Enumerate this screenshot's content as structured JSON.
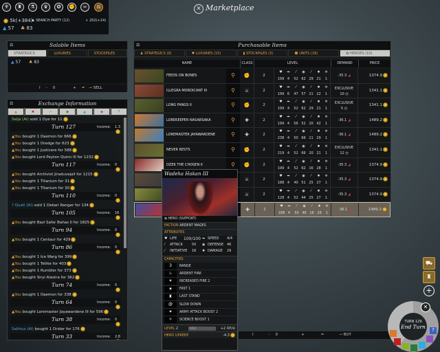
{
  "topbar": {
    "empire_icons": [
      "wreath-emblem-icon",
      "tower-emblem-icon",
      "flask-emblem-icon",
      "trophy-emblem-icon",
      "medal-emblem-icon",
      "fist-emblem-icon",
      "handshake-emblem-icon",
      "marketplace-emblem-icon"
    ],
    "dust": "5k(+384)",
    "search_party": "SEARCH PARTY (12)",
    "stars": "202(+14)",
    "influence": "57",
    "food": "83"
  },
  "title": "Marketplace",
  "salable": {
    "title": "Salable Items",
    "tabs": [
      "STRATEGICS",
      "LUXURIES",
      "STOCKPILES"
    ],
    "active_tab": 0,
    "resources": [
      {
        "icon": "influence-icon",
        "value": "57"
      },
      {
        "icon": "food-icon",
        "value": "83"
      }
    ],
    "quantity": "0",
    "sell_label": "SELL"
  },
  "exchange": {
    "title": "Exchange Information",
    "filters": [
      "orange-empire",
      "red-empire",
      "green-empire",
      "olive-empire",
      "cyan-empire",
      "purple-empire",
      "unknown-empire"
    ],
    "filter_glyphs": [
      "▲",
      "✖",
      "↗",
      "◉",
      "▲",
      "◆",
      "?"
    ],
    "entries": [
      {
        "lines": [
          {
            "who": "Selja (AI)",
            "whoClass": "green",
            "text": " sold 1 Dye for 11"
          }
        ],
        "turn": "Turn 127",
        "income": "1.3"
      },
      {
        "lines": [
          {
            "who": "You",
            "whoClass": "you",
            "text": " bought 1 Daemon for 666"
          },
          {
            "who": "You",
            "whoClass": "you",
            "text": " bought 1 Dredge for 623"
          },
          {
            "who": "You",
            "whoClass": "you",
            "text": " bought 1 Justicere for 588"
          },
          {
            "who": "You",
            "whoClass": "you",
            "text": " bought Lord Peyton Quinn III for 1232"
          }
        ],
        "turn": "Turn 117",
        "income": "0"
      },
      {
        "lines": [
          {
            "who": "You",
            "whoClass": "you",
            "text": " bought Archivist Jiraduvejall for 1215"
          },
          {
            "who": "You",
            "whoClass": "you",
            "text": " bought 1 Titanium for 31"
          },
          {
            "who": "You",
            "whoClass": "you",
            "text": " bought 1 Titanium for 30"
          }
        ],
        "turn": "Turn 110",
        "income": "0"
      },
      {
        "lines": [
          {
            "who": "? Quatl (AI)",
            "whoClass": "blue",
            "text": " sold 1 Dekari Ranger for 134"
          }
        ],
        "turn": "Turn 105",
        "income": "16"
      },
      {
        "lines": [
          {
            "who": "You",
            "whoClass": "you",
            "text": " bought Bazi Safar Bahas II for 1825"
          }
        ],
        "turn": "Turn 94",
        "income": "0"
      },
      {
        "lines": [
          {
            "who": "You",
            "whoClass": "you",
            "text": " bought 1 Centaur for 429"
          }
        ],
        "turn": "Turn 86",
        "income": "0"
      },
      {
        "lines": [
          {
            "who": "You",
            "whoClass": "you",
            "text": " bought 1 Ice Warg for 399"
          },
          {
            "who": "You",
            "whoClass": "you",
            "text": " bought 1 Tetike for 403"
          },
          {
            "who": "You",
            "whoClass": "you",
            "text": " bought 1 Rumbler for 373"
          },
          {
            "who": "You",
            "whoClass": "you",
            "text": " bought Siryi Alastra for 362"
          }
        ],
        "turn": "Turn 74",
        "income": "0"
      },
      {
        "lines": [
          {
            "who": "You",
            "whoClass": "you",
            "text": " bought 1 Daemon for 338"
          }
        ],
        "turn": "Turn 64",
        "income": "0"
      },
      {
        "lines": [
          {
            "who": "You",
            "whoClass": "you",
            "text": " bought Loremaster Jayawardene III for 596"
          }
        ],
        "turn": "Turn 38",
        "income": "0"
      },
      {
        "lines": [
          {
            "who": "Salthus (AI)",
            "whoClass": "blue",
            "text": " bought 1 Drider for 176"
          }
        ],
        "turn": "Turn 33",
        "income": "2.8"
      }
    ],
    "income_label": "Income:"
  },
  "purchasable": {
    "title": "Purchasable Items",
    "tabs": [
      "STRATEGICS (0)",
      "LUXURIES (15)",
      "STOCKPILES (3)",
      "UNITS (18)",
      "HEROES (10)"
    ],
    "active_tab": 4,
    "columns": [
      "NAME",
      "CLASS",
      "LEVEL",
      "DEMAND",
      "PRICE"
    ],
    "stat_icons": [
      "heart-icon",
      "arrow-icon",
      "sword-icon",
      "shield-icon",
      "initiative-icon",
      "damage-icon",
      "gear-icon"
    ],
    "rows": [
      {
        "name": "FEEDS ON BONES",
        "class": "fist",
        "level": "2",
        "stats": [
          "199",
          "4",
          "52",
          "62",
          "29",
          "21",
          "1"
        ],
        "demand": "-35.3",
        "exclusive": false,
        "price": "1374.9",
        "selected": false
      },
      {
        "name": "ILLEGRA MORDICANT III",
        "class": "crossed-swords",
        "level": "2",
        "stats": [
          "199",
          "6",
          "47",
          "57",
          "21",
          "22",
          "1"
        ],
        "demand": "EXCLUSIVE",
        "exclusive_turns": "10",
        "exclusive": true,
        "price": "1341.1",
        "selected": false
      },
      {
        "name": "LONG FANGS II",
        "class": "fist",
        "level": "2",
        "stats": [
          "199",
          "4",
          "52",
          "62",
          "29",
          "21",
          "1"
        ],
        "demand": "EXCLUSIVE",
        "exclusive_turns": "5",
        "exclusive": true,
        "price": "1341.1",
        "selected": false
      },
      {
        "name": "LOREKEEPER NASARSAKA",
        "class": "support",
        "level": "2",
        "stats": [
          "199",
          "4",
          "56",
          "52",
          "20",
          "42",
          "1"
        ],
        "demand": "-36.1",
        "exclusive": false,
        "price": "1489.2",
        "selected": false
      },
      {
        "name": "LOREMASTER JAYAWARDENE",
        "class": "support",
        "level": "2",
        "stats": [
          "238",
          "4",
          "50",
          "66",
          "11",
          "29",
          "1"
        ],
        "demand": "-36.1",
        "exclusive": false,
        "price": "1489.2",
        "selected": false
      },
      {
        "name": "NEVER RESTS",
        "class": "fist",
        "level": "2",
        "stats": [
          "219",
          "4",
          "52",
          "66",
          "20",
          "21",
          "1"
        ],
        "demand": "EXCLUSIVE",
        "exclusive_turns": "12",
        "exclusive": true,
        "price": "1341.1",
        "selected": false
      },
      {
        "name": "OZEK THE CHOSEN II",
        "class": "fist",
        "level": "2",
        "stats": [
          "199",
          "4",
          "52",
          "62",
          "16",
          "28",
          "1"
        ],
        "demand": "-35.3",
        "exclusive": false,
        "price": "1374.9",
        "selected": false
      },
      {
        "name": "",
        "class": "crossed-swords",
        "level": "2",
        "stats": [
          "188",
          "4",
          "40",
          "51",
          "25",
          "27",
          "1"
        ],
        "demand": "-35.3",
        "exclusive": false,
        "price": "1374.9",
        "selected": false
      },
      {
        "name": "",
        "class": "crossed-swords",
        "level": "2",
        "stats": [
          "128",
          "4",
          "52",
          "44",
          "25",
          "27",
          "1"
        ],
        "demand": "-35.3",
        "exclusive": false,
        "price": "1374.9",
        "selected": false
      },
      {
        "name": "",
        "class": "support",
        "level": "2",
        "stats": [
          "188",
          "4",
          "50",
          "46",
          "16",
          "29",
          "1"
        ],
        "demand": "-36.1",
        "exclusive": false,
        "price": "1489.2",
        "selected": true
      }
    ],
    "quantity": "0",
    "buy_label": "BUY"
  },
  "tooltip": {
    "name": "Wadeha Hakan III",
    "type": "HERO (SUPPORT)",
    "faction_label": "FACTION",
    "faction": "ARDENT MAGES",
    "attributes_label": "ATTRIBUTES",
    "attributes": {
      "life_label": "LIFE",
      "life": "100/100",
      "speed_label": "SPEED",
      "speed": "4/4",
      "attack_label": "ATTACK",
      "attack": "50",
      "defense_label": "DEFENSE",
      "defense": "46",
      "initiative_label": "INITIATIVE",
      "initiative": "16",
      "damage_label": "DAMAGE",
      "damage": "29"
    },
    "capacities_label": "CAPACITIES",
    "capacities": [
      {
        "icon": "range-icon",
        "glyph": "3",
        "label": "RANGE"
      },
      {
        "icon": "fire-icon",
        "glyph": "♨",
        "label": "ARDENT FIRE"
      },
      {
        "icon": "increased-fire-icon",
        "glyph": "✶",
        "label": "INCREASED FIRE 2"
      },
      {
        "icon": "fast-icon",
        "glyph": "✷",
        "label": "FAST 1"
      },
      {
        "icon": "last-stand-icon",
        "glyph": "♜",
        "label": "LAST STAND"
      },
      {
        "icon": "slow-down-icon",
        "glyph": "@",
        "label": "SLOW DOWN"
      },
      {
        "icon": "army-attack-boost-icon",
        "glyph": "✦",
        "label": "ARMY ATTACK BOOST 2"
      },
      {
        "icon": "science-boost-icon",
        "glyph": "✧",
        "label": "SCIENCE BOOST 1"
      }
    ],
    "level_label": "LEVEL",
    "level": "2",
    "xp_progress": "0/83",
    "xp_gain": "+2 XP/",
    "upkeep_label": "HERO UPKEEP",
    "upkeep": "-4.3"
  },
  "turn": {
    "label": "TURN 129",
    "end_turn": "End Turn"
  },
  "colors": {
    "accent": "#e4a33a",
    "selected_row": "#6a6257",
    "panel": "#141618"
  }
}
